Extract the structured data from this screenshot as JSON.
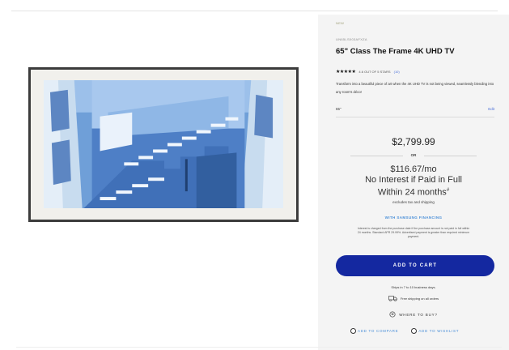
{
  "product": {
    "new_badge": "NEW",
    "model": "UN65LS003AFXZA",
    "title": "65\" Class The Frame 4K UHD TV",
    "stars": "★★★★★",
    "rating_text": "4.6 OUT OF 5 STARS",
    "review_count": "(10)",
    "description": "Transform into a beautiful piece of art when the 4K UHD TV is not being viewed, seamlessly blending into any room's décor",
    "size_value": "65\"",
    "size_edit": "Edit"
  },
  "pricing": {
    "price": "$2,799.99",
    "or_label": "OR",
    "monthly_line1": "$116.67/mo",
    "monthly_line2": "No Interest if Paid in Full",
    "monthly_line3": "Within 24 months",
    "footnote_mark": "#",
    "taxes_note": "excludes tax and shipping",
    "financing_link": "WITH SAMSUNG FINANCING",
    "fine_print": "Interest is charged from the purchase date if the purchase amount is not paid in full within 24 months. Standard APR 29.99%. Advertised payment is greater than required minimum payment."
  },
  "actions": {
    "add_to_cart": "ADD TO CART",
    "ships_note": "Ships in 7 to 10 business days.",
    "free_shipping": "Free shipping on all orders",
    "where_to_buy": "WHERE TO BUY?",
    "add_to_compare": "ADD TO COMPARE",
    "add_to_wishlist": "ADD TO WISHLIST"
  },
  "colors": {
    "cart_button": "#1428a0",
    "link": "#4a8fd8",
    "panel_bg": "#f4f4f4"
  }
}
